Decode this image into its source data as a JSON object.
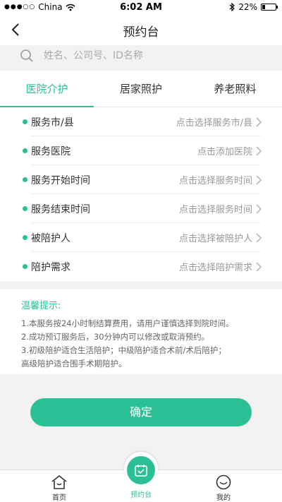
{
  "status_bar": {
    "carrier": "China",
    "time": "6:02 AM",
    "battery": "22%",
    "battery_level": 0.22,
    "signal_dots": "●●●○○"
  },
  "nav": {
    "title": "预约台",
    "back_icon": "chevron-left-icon"
  },
  "search": {
    "placeholder": "姓名、公司号、ID名称",
    "icon": "search-icon"
  },
  "tabs": [
    {
      "label": "医院介护",
      "active": true
    },
    {
      "label": "居家照护",
      "active": false
    },
    {
      "label": "养老照料",
      "active": false
    }
  ],
  "form": {
    "rows": [
      {
        "label": "服务市/县",
        "value": "点击选择服务市/县"
      },
      {
        "label": "服务医院",
        "value": "点击添加医院"
      },
      {
        "label": "服务开始时间",
        "value": "点击选择服务时间"
      },
      {
        "label": "服务结束时间",
        "value": "点击选择服务时间"
      },
      {
        "label": "被陪护人",
        "value": "点击选择被陪护人"
      },
      {
        "label": "陪护需求",
        "value": "点击选择陪护需求"
      }
    ]
  },
  "tips": {
    "title": "温馨提示:",
    "lines": [
      "1.本服务按24小时制结算费用，请用户谨慎选择到院时间。",
      "2.成功预订服务后，30分钟内可以修改或取消预约。",
      "3.初级陪护适合生活陪护；中级陪护适合术前/术后陪护；",
      "高级陪护适合围手术期陪护。"
    ]
  },
  "confirm_label": "确定",
  "bottom_tabs": [
    {
      "label": "首页",
      "icon": "home-icon"
    },
    {
      "label": "预约台",
      "icon": "calendar-check-icon"
    },
    {
      "label": "我的",
      "icon": "smiley-icon"
    }
  ],
  "colors": {
    "accent": "#2bbf96",
    "background": "#f2f2f2"
  }
}
